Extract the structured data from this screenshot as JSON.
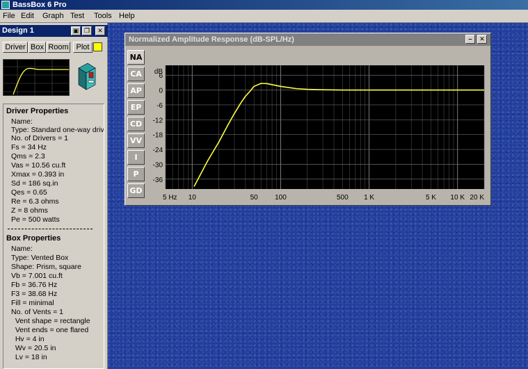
{
  "app": {
    "title": "BassBox 6 Pro"
  },
  "menu": [
    "File",
    "Edit",
    "Graph",
    "Test",
    "Tools",
    "Help"
  ],
  "design": {
    "title": "Design 1",
    "tabs": [
      "Driver",
      "Box",
      "Room",
      "Plot"
    ],
    "plot_color": "#ffff00",
    "driver_heading": "Driver Properties",
    "driver_lines": [
      "Name:",
      "Type: Standard one-way driv",
      "No. of Drivers = 1",
      "Fs = 34 Hz",
      "Qms = 2.3",
      "Vas = 10.56 cu.ft",
      "Xmax = 0.393 in",
      "Sd = 186 sq.in",
      "Qes = 0.65",
      "Re = 6.3 ohms",
      "Z = 8 ohms",
      "Pe = 500 watts"
    ],
    "box_heading": "Box Properties",
    "box_lines": [
      "Name:",
      "Type: Vented Box",
      "Shape: Prism, square",
      "Vb = 7.001 cu.ft",
      "Fb = 36.76 Hz",
      "F3 = 38.68 Hz",
      "Fill = minimal",
      "No. of Vents = 1",
      "  Vent shape = rectangle",
      "  Vent ends = one flared",
      "  Hv = 4 in",
      "  Wv = 20.5 in",
      "  Lv = 18 in"
    ]
  },
  "graph": {
    "title": "Normalized Amplitude Response (dB-SPL/Hz)",
    "tabs": [
      "NA",
      "CA",
      "AP",
      "EP",
      "CD",
      "VV",
      "I",
      "P",
      "GD"
    ],
    "active_tab": "NA"
  },
  "chart_data": {
    "type": "line",
    "xscale": "log",
    "xlim": [
      5,
      20000
    ],
    "ylim": [
      -40,
      10
    ],
    "ylabel": "dB",
    "y_ticks": [
      6,
      0,
      -6,
      -12,
      -18,
      -24,
      -30,
      -36
    ],
    "x_tick_labels": [
      {
        "v": 5,
        "t": "5 Hz"
      },
      {
        "v": 10,
        "t": "10"
      },
      {
        "v": 50,
        "t": "50"
      },
      {
        "v": 100,
        "t": "100"
      },
      {
        "v": 500,
        "t": "500"
      },
      {
        "v": 1000,
        "t": "1 K"
      },
      {
        "v": 5000,
        "t": "5 K"
      },
      {
        "v": 10000,
        "t": "10 K"
      },
      {
        "v": 20000,
        "t": "20 K"
      }
    ],
    "grid": true,
    "series": [
      {
        "color": "#ffff44",
        "x": [
          10.5,
          15,
          20,
          25,
          30,
          35,
          40,
          45,
          50,
          60,
          70,
          80,
          100,
          150,
          200,
          300,
          500,
          1000,
          5000,
          10000,
          20000
        ],
        "y": [
          -39,
          -28.5,
          -21,
          -14.5,
          -9.5,
          -5.5,
          -2.5,
          -0.5,
          1.5,
          2.7,
          2.6,
          2.2,
          1.5,
          0.6,
          0.3,
          0.1,
          0,
          0,
          0,
          0,
          0
        ]
      }
    ]
  }
}
